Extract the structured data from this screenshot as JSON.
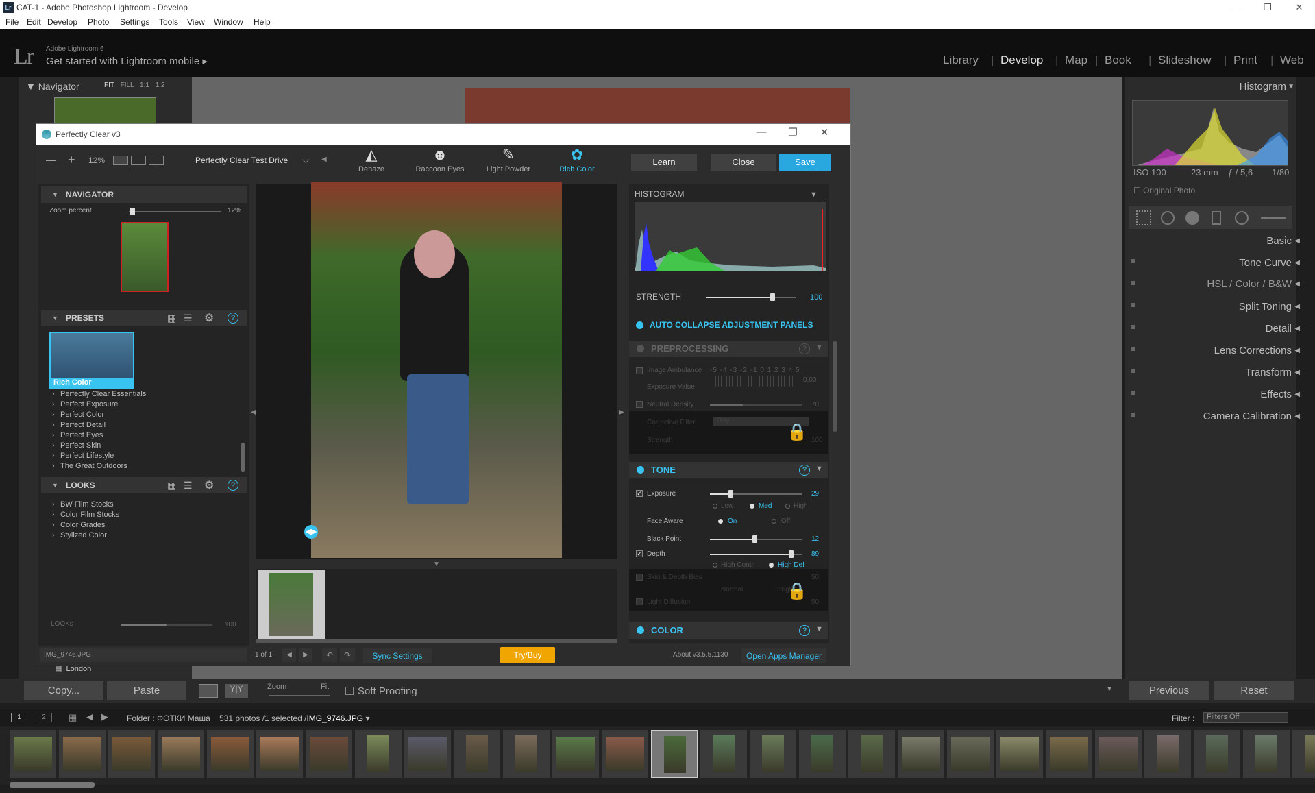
{
  "window": {
    "title": "CAT-1 - Adobe Photoshop Lightroom - Develop",
    "app_icon": "Lr",
    "minimize": "—",
    "restore": "❐",
    "close": "✕"
  },
  "menu": [
    "File",
    "Edit",
    "Develop",
    "Photo",
    "Settings",
    "Tools",
    "View",
    "Window",
    "Help"
  ],
  "header": {
    "logo": "Lr",
    "version": "Adobe Lightroom 6",
    "mobile": "Get started with Lightroom mobile ▸"
  },
  "modules": [
    "Library",
    "Develop",
    "Map",
    "Book",
    "Slideshow",
    "Print",
    "Web"
  ],
  "module_sep": "|",
  "active_module": "Develop",
  "left": {
    "navigator": "Navigator",
    "zoom_opts": [
      "FIT",
      "FILL",
      "1:1",
      "1:2"
    ],
    "folder_item": "London",
    "copy": "Copy...",
    "paste": "Paste"
  },
  "right": {
    "histogram": "Histogram",
    "iso": "ISO 100",
    "focal": "23 mm",
    "aperture": "ƒ / 5,6",
    "shutter": "1/80",
    "original": "Original Photo",
    "panels": [
      "Basic",
      "Tone Curve",
      "HSL / Color / B&W",
      "Split Toning",
      "Detail",
      "Lens Corrections",
      "Transform",
      "Effects",
      "Camera Calibration"
    ],
    "previous": "Previous",
    "reset": "Reset"
  },
  "toolbar": {
    "zoom": "Zoom",
    "fit": "Fit",
    "soft_proofing": "Soft Proofing"
  },
  "filmbar": {
    "page1": "1",
    "page2": "2",
    "folder": "Folder : ФОТКИ Маша",
    "count": "531 photos /1 selected /",
    "file": "IMG_9746.JPG",
    "filter_label": "Filter :",
    "filter_value": "Filters Off"
  },
  "pc": {
    "title": "Perfectly Clear v3",
    "zoom_minus": "—",
    "zoom_plus": "+",
    "zoom": "12%",
    "preset_name": "Perfectly Clear Test Drive",
    "tabs": [
      {
        "label": "Dehaze",
        "glyph": "◭"
      },
      {
        "label": "Raccoon Eyes",
        "glyph": "☻"
      },
      {
        "label": "Light Powder",
        "glyph": "✎"
      },
      {
        "label": "Rich Color",
        "glyph": "✿"
      }
    ],
    "learn": "Learn",
    "close": "Close",
    "save": "Save",
    "navigator": "NAVIGATOR",
    "zoom_percent": "Zoom percent",
    "zoom_val": "12%",
    "presets": "PRESETS",
    "selected_preset": "Rich Color",
    "preset_list": [
      "Perfectly Clear Essentials",
      "Perfect Exposure",
      "Perfect Color",
      "Perfect Detail",
      "Perfect Eyes",
      "Perfect Skin",
      "Perfect Lifestyle",
      "The Great Outdoors"
    ],
    "looks": "LOOKS",
    "looks_list": [
      "BW Film Stocks",
      "Color Film Stocks",
      "Color Grades",
      "Stylized Color"
    ],
    "looks_slider_label": "LOOKs",
    "looks_slider_val": "100",
    "histogram": "HISTOGRAM",
    "strength": "STRENGTH",
    "strength_val": "100",
    "auto_collapse": "AUTO COLLAPSE ADJUSTMENT PANELS",
    "preprocessing": "PREPROCESSING",
    "image_ambulance": "Image Ambulance",
    "ambulance_scale": "-5 -4 -3 -2 -1 0 1 2 3 4 5",
    "exposure_value": "Exposure Value",
    "exposure_value_num": "0,00",
    "neutral_density": "Neutral Density",
    "neutral_val": "70",
    "corrective_filter": "Corrective Filter",
    "corrective_opt": "Only",
    "strength2": "Strength",
    "strength2_val": "100",
    "tone": "TONE",
    "exposure": "Exposure",
    "exposure_val": "29",
    "low": "Low",
    "med": "Med",
    "high": "High",
    "face_aware": "Face Aware",
    "on": "On",
    "off": "Off",
    "black_point": "Black Point",
    "black_val": "12",
    "depth": "Depth",
    "depth_val": "89",
    "high_contr": "High Contr",
    "high_def": "High Def",
    "skin_depth": "Skin & Depth Bias",
    "skin_val": "50",
    "normal": "Normal",
    "bright": "Bright",
    "light_diffusion": "Light Diffusion",
    "diffusion_val": "50",
    "color": "COLOR",
    "qm": "?",
    "filename": "IMG_9746.JPG",
    "page": "1 of 1",
    "sync": "Sync Settings",
    "trybuy": "Try/Buy",
    "about": "About v3.5.5.1130",
    "apps_manager": "Open Apps Manager"
  },
  "colors": {
    "accent": "#39c3f0",
    "save": "#29a8e0",
    "trybuy": "#f0a500"
  }
}
